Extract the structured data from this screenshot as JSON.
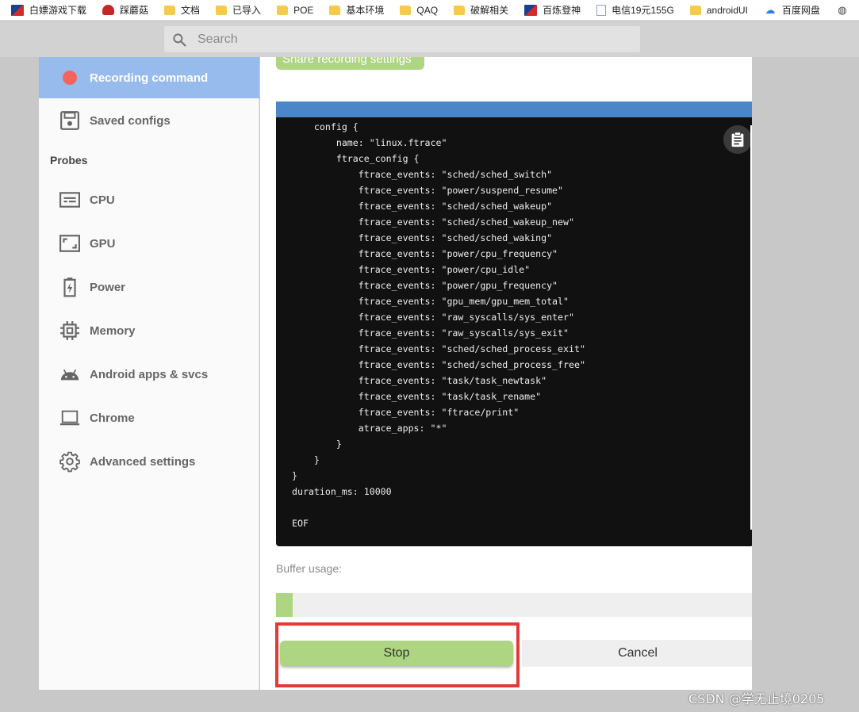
{
  "bookmarks": [
    {
      "label": "白嫖游戏下载",
      "icon": "flag-favicon"
    },
    {
      "label": "踩蘑菇",
      "icon": "mushroom-favicon"
    },
    {
      "label": "文档",
      "icon": "folder-icon"
    },
    {
      "label": "已导入",
      "icon": "folder-icon"
    },
    {
      "label": "POE",
      "icon": "folder-icon"
    },
    {
      "label": "基本环境",
      "icon": "folder-icon"
    },
    {
      "label": "QAQ",
      "icon": "folder-icon"
    },
    {
      "label": "破解相关",
      "icon": "folder-icon"
    },
    {
      "label": "百炼登神",
      "icon": "flag-favicon"
    },
    {
      "label": "电信19元155G",
      "icon": "document-favicon"
    },
    {
      "label": "androidUI",
      "icon": "folder-icon"
    },
    {
      "label": "百度网盘",
      "icon": "cloud-favicon"
    }
  ],
  "search": {
    "placeholder": "Search"
  },
  "sidebar": {
    "items": [
      {
        "label": "Recording command",
        "icon": "record-dot-icon",
        "active": true
      },
      {
        "label": "Saved configs",
        "icon": "floppy-disk-icon"
      }
    ],
    "probes_header": "Probes",
    "probes": [
      {
        "label": "CPU",
        "icon": "cpu-icon"
      },
      {
        "label": "GPU",
        "icon": "gpu-icon"
      },
      {
        "label": "Power",
        "icon": "battery-icon"
      },
      {
        "label": "Memory",
        "icon": "memory-chip-icon"
      },
      {
        "label": "Android apps & svcs",
        "icon": "android-icon"
      },
      {
        "label": "Chrome",
        "icon": "laptop-icon"
      },
      {
        "label": "Advanced settings",
        "icon": "gear-icon"
      }
    ]
  },
  "main": {
    "share_button": "Share recording settings",
    "command_text": "    config {\n        name: \"linux.ftrace\"\n        ftrace_config {\n            ftrace_events: \"sched/sched_switch\"\n            ftrace_events: \"power/suspend_resume\"\n            ftrace_events: \"sched/sched_wakeup\"\n            ftrace_events: \"sched/sched_wakeup_new\"\n            ftrace_events: \"sched/sched_waking\"\n            ftrace_events: \"power/cpu_frequency\"\n            ftrace_events: \"power/cpu_idle\"\n            ftrace_events: \"power/gpu_frequency\"\n            ftrace_events: \"gpu_mem/gpu_mem_total\"\n            ftrace_events: \"raw_syscalls/sys_enter\"\n            ftrace_events: \"raw_syscalls/sys_exit\"\n            ftrace_events: \"sched/sched_process_exit\"\n            ftrace_events: \"sched/sched_process_free\"\n            ftrace_events: \"task/task_newtask\"\n            ftrace_events: \"task/task_rename\"\n            ftrace_events: \"ftrace/print\"\n            atrace_apps: \"*\"\n        }\n    }\n}\nduration_ms: 10000\n\nEOF",
    "buffer_label": "Buffer usage:",
    "buffer_usage_fraction": 0.035,
    "stop_button": "Stop",
    "cancel_button": "Cancel"
  },
  "watermark": "CSDN @学无止境0205",
  "colors": {
    "accent_green": "#aed581",
    "active_nav": "#98bbee",
    "record_dot": "#f4645f",
    "highlight_red": "#e53935",
    "code_header": "#4a86c8"
  }
}
